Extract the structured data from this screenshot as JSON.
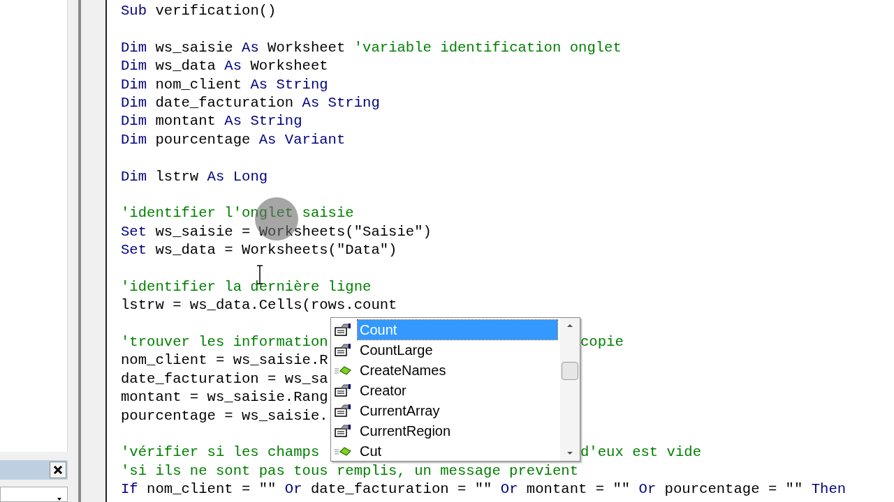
{
  "code_blocks": [
    [
      {
        "tokens": [
          {
            "kind": "kw",
            "text": "Sub"
          },
          {
            "kind": "text",
            "text": " verification()"
          }
        ]
      }
    ],
    [
      {
        "tokens": [
          {
            "kind": "kw",
            "text": "Dim"
          },
          {
            "kind": "text",
            "text": " ws_saisie "
          },
          {
            "kind": "kw",
            "text": "As"
          },
          {
            "kind": "text",
            "text": " Worksheet "
          },
          {
            "kind": "comment",
            "text": "'variable identification onglet"
          }
        ]
      },
      {
        "tokens": [
          {
            "kind": "kw",
            "text": "Dim"
          },
          {
            "kind": "text",
            "text": " ws_data "
          },
          {
            "kind": "kw",
            "text": "As"
          },
          {
            "kind": "text",
            "text": " Worksheet"
          }
        ]
      },
      {
        "tokens": [
          {
            "kind": "kw",
            "text": "Dim"
          },
          {
            "kind": "text",
            "text": " nom_client "
          },
          {
            "kind": "kw",
            "text": "As String"
          }
        ]
      },
      {
        "tokens": [
          {
            "kind": "kw",
            "text": "Dim"
          },
          {
            "kind": "text",
            "text": " date_facturation "
          },
          {
            "kind": "kw",
            "text": "As String"
          }
        ]
      },
      {
        "tokens": [
          {
            "kind": "kw",
            "text": "Dim"
          },
          {
            "kind": "text",
            "text": " montant "
          },
          {
            "kind": "kw",
            "text": "As String"
          }
        ]
      },
      {
        "tokens": [
          {
            "kind": "kw",
            "text": "Dim"
          },
          {
            "kind": "text",
            "text": " pourcentage "
          },
          {
            "kind": "kw",
            "text": "As Variant"
          }
        ]
      }
    ],
    [
      {
        "tokens": [
          {
            "kind": "kw",
            "text": "Dim"
          },
          {
            "kind": "text",
            "text": " lstrw "
          },
          {
            "kind": "kw",
            "text": "As Long"
          }
        ]
      }
    ],
    [
      {
        "tokens": [
          {
            "kind": "comment",
            "text": "'identifier l'onglet saisie"
          }
        ]
      },
      {
        "tokens": [
          {
            "kind": "kw",
            "text": "Set"
          },
          {
            "kind": "text",
            "text": " ws_saisie = Worksheets(\"Saisie\")"
          }
        ]
      },
      {
        "tokens": [
          {
            "kind": "kw",
            "text": "Set"
          },
          {
            "kind": "text",
            "text": " ws_data = Worksheets(\"Data\")"
          }
        ]
      }
    ],
    [
      {
        "tokens": [
          {
            "kind": "comment",
            "text": "'identifier la dernière ligne"
          }
        ]
      },
      {
        "tokens": [
          {
            "kind": "text",
            "text": "lstrw = ws_data.Cells(rows.count"
          }
        ]
      }
    ],
    [
      {
        "tokens": [
          {
            "kind": "comment",
            "text": "'trouver les information"
          }
        ],
        "after": [
          {
            "kind": "comment",
            "text": "copie"
          }
        ]
      },
      {
        "tokens": [
          {
            "kind": "text",
            "text": "nom_client = ws_saisie.R"
          }
        ]
      },
      {
        "tokens": [
          {
            "kind": "text",
            "text": "date_facturation = ws_sa"
          }
        ]
      },
      {
        "tokens": [
          {
            "kind": "text",
            "text": "montant = ws_saisie.Rang"
          }
        ]
      },
      {
        "tokens": [
          {
            "kind": "text",
            "text": "pourcentage = ws_saisie."
          }
        ]
      }
    ],
    [
      {
        "tokens": [
          {
            "kind": "comment",
            "text": "'vérifier si les champs"
          }
        ],
        "after": [
          {
            "kind": "comment",
            "text": "d'eux est vide"
          }
        ]
      },
      {
        "tokens": [
          {
            "kind": "comment",
            "text": "'si ils ne sont pas tous remplis, un message previent"
          }
        ]
      },
      {
        "tokens": [
          {
            "kind": "kw",
            "text": "If"
          },
          {
            "kind": "text",
            "text": " nom_client = \"\" "
          },
          {
            "kind": "kw",
            "text": "Or"
          },
          {
            "kind": "text",
            "text": " date_facturation = \"\" "
          },
          {
            "kind": "kw",
            "text": "Or"
          },
          {
            "kind": "text",
            "text": " montant = \"\" "
          },
          {
            "kind": "kw",
            "text": "Or"
          },
          {
            "kind": "text",
            "text": " pourcentage = \"\" "
          },
          {
            "kind": "kw",
            "text": "Then"
          }
        ]
      }
    ]
  ],
  "autocomplete": {
    "items": [
      {
        "label": "Count",
        "kind": "property",
        "selected": true
      },
      {
        "label": "CountLarge",
        "kind": "property",
        "selected": false
      },
      {
        "label": "CreateNames",
        "kind": "method",
        "selected": false
      },
      {
        "label": "Creator",
        "kind": "property",
        "selected": false
      },
      {
        "label": "CurrentArray",
        "kind": "property",
        "selected": false
      },
      {
        "label": "CurrentRegion",
        "kind": "property",
        "selected": false
      },
      {
        "label": "Cut",
        "kind": "method",
        "selected": false
      }
    ]
  }
}
